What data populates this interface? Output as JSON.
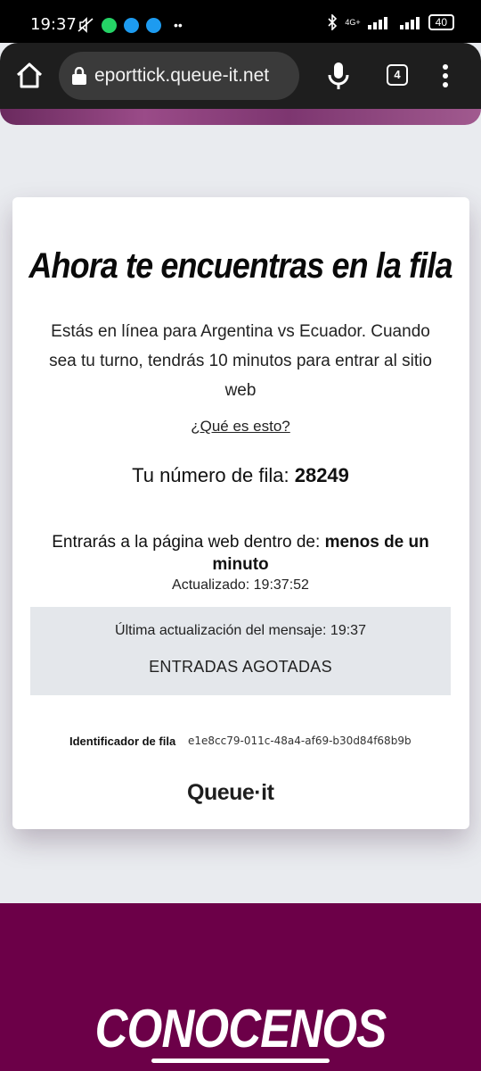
{
  "status_bar": {
    "time": "19:37",
    "network": "4G+",
    "battery": "40",
    "notification_icons": [
      "mute-icon",
      "whatsapp-icon",
      "twitter-icon",
      "twitter-icon",
      "more-dots-icon"
    ],
    "colors": {
      "whatsapp": "#25d366",
      "twitter": "#1d9bf0"
    }
  },
  "browser": {
    "url": "eporttick.queue-it.net",
    "tab_count": "4"
  },
  "queue": {
    "title": "Ahora te encuentras en la fila",
    "intro": "Estás en línea para Argentina vs Ecuador. Cuando sea tu turno, tendrás  10 minutos para entrar al sitio web",
    "what_is_this": "¿Qué es esto?",
    "queue_number_label": "Tu número de fila:",
    "queue_number": "28249",
    "eta_label": "Entrarás a la página web dentro de:",
    "eta_value": "menos de un minuto",
    "updated": "Actualizado: 19:37:52",
    "message": {
      "last_update": "Última actualización del mensaje: 19:37",
      "text": "ENTRADAS AGOTADAS"
    },
    "queue_id_label": "Identificador de fila",
    "queue_id": "e1e8cc79-011c-48a4-af69-b30d84f68b9b",
    "brand": "Queue·it"
  },
  "footer": {
    "title": "CONOCENOS",
    "bg_color": "#6c0048"
  }
}
